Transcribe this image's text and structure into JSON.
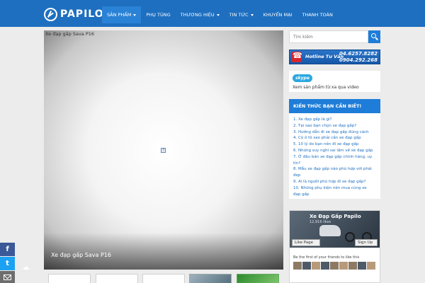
{
  "brand": {
    "name": "PAPILO"
  },
  "nav": {
    "items": [
      {
        "label": "Sản phẩm",
        "dropdown": true,
        "active": true
      },
      {
        "label": "Phụ tùng",
        "dropdown": false
      },
      {
        "label": "Thương hiệu",
        "dropdown": true
      },
      {
        "label": "Tin tức",
        "dropdown": true
      },
      {
        "label": "Khuyến mại",
        "dropdown": false
      },
      {
        "label": "Thanh toán",
        "dropdown": false
      }
    ]
  },
  "slider": {
    "image_alt": "Xe đạp gấp Sava P16",
    "caption": "Xe đạp gấp Sava P16"
  },
  "sidebar": {
    "search": {
      "placeholder": "Tìm kiếm"
    },
    "hotline": {
      "label": "Hotline Tư Vấn",
      "phone_1": "04.6257.8282",
      "phone_2": "0904.292.268"
    },
    "skype": {
      "logo": "skype",
      "text": "Xem sản phẩm từ xa qua video"
    },
    "knowledge": {
      "title": "KIẾN THỨC BẠN CẦN BIẾT!",
      "items": [
        "1. Xe đạp gấp là gì?",
        "2. Tại sao bạn chọn xe đạp gấp?",
        "3. Hướng dẫn đi xe đạp gấp đúng cách",
        "4. Có ô tô sao phải cần xe đạp gấp",
        "5. 10 lý do bạn nên đi xe đạp gấp",
        "6. Những suy nghĩ sai lầm về xe đạp gấp",
        "7. Ở đâu bán xe đạp gấp chính hãng, uy",
        "tín?",
        "8. Mẫu xe đạp gấp nào phù hợp với phái",
        "đẹp",
        "9. Ai là người phù hợp đi xe đạp gấp?",
        "10. Những phụ kiện nên mua cùng xe",
        "đạp gấp"
      ]
    },
    "facebook": {
      "page_name": "Xe Đạp Gấp Papilo",
      "likes": "12,916 likes",
      "like_label": "Like Page",
      "signup_label": "Sign Up",
      "friends_text": "Be the first of your friends to like this"
    }
  },
  "social": {
    "facebook": "f",
    "twitter": "t"
  },
  "colors": {
    "header": "#1e6fbf",
    "accent": "#1e7dd8",
    "hotline_red": "#d7262d"
  }
}
